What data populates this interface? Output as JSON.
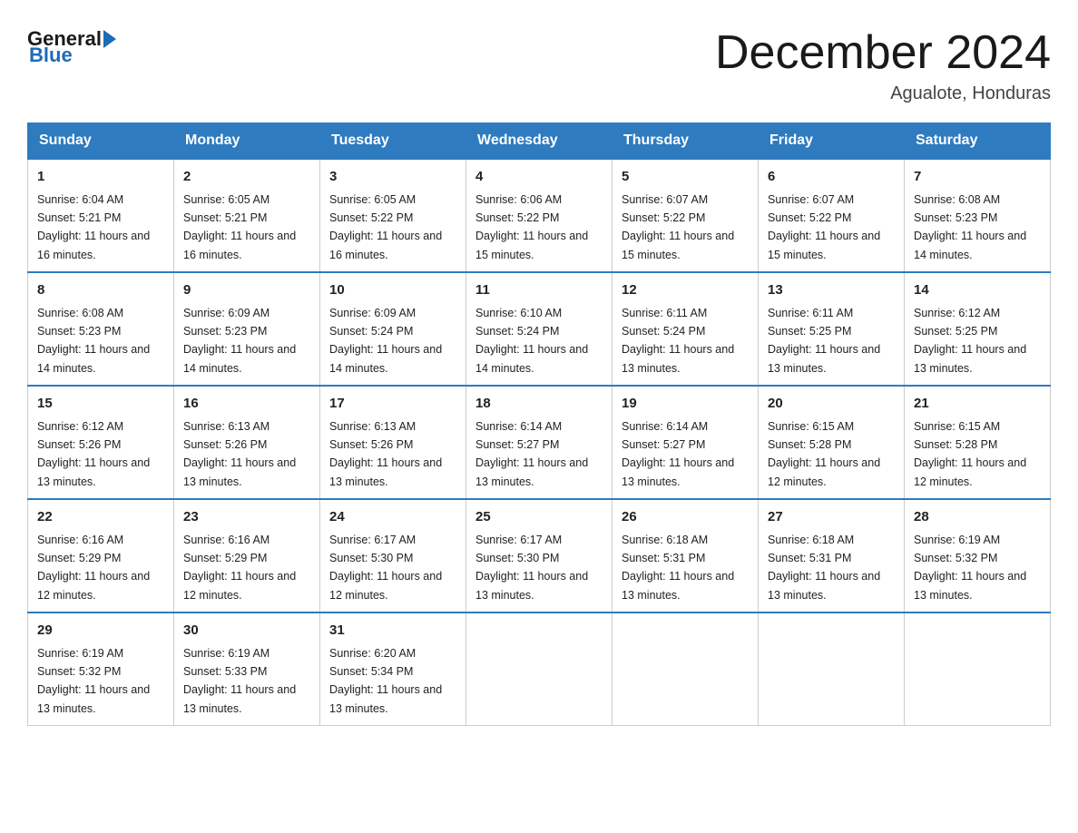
{
  "header": {
    "logo_general": "General",
    "logo_blue": "Blue",
    "title": "December 2024",
    "location": "Agualote, Honduras"
  },
  "days_of_week": [
    "Sunday",
    "Monday",
    "Tuesday",
    "Wednesday",
    "Thursday",
    "Friday",
    "Saturday"
  ],
  "weeks": [
    [
      {
        "day": "1",
        "sunrise": "6:04 AM",
        "sunset": "5:21 PM",
        "daylight": "11 hours and 16 minutes."
      },
      {
        "day": "2",
        "sunrise": "6:05 AM",
        "sunset": "5:21 PM",
        "daylight": "11 hours and 16 minutes."
      },
      {
        "day": "3",
        "sunrise": "6:05 AM",
        "sunset": "5:22 PM",
        "daylight": "11 hours and 16 minutes."
      },
      {
        "day": "4",
        "sunrise": "6:06 AM",
        "sunset": "5:22 PM",
        "daylight": "11 hours and 15 minutes."
      },
      {
        "day": "5",
        "sunrise": "6:07 AM",
        "sunset": "5:22 PM",
        "daylight": "11 hours and 15 minutes."
      },
      {
        "day": "6",
        "sunrise": "6:07 AM",
        "sunset": "5:22 PM",
        "daylight": "11 hours and 15 minutes."
      },
      {
        "day": "7",
        "sunrise": "6:08 AM",
        "sunset": "5:23 PM",
        "daylight": "11 hours and 14 minutes."
      }
    ],
    [
      {
        "day": "8",
        "sunrise": "6:08 AM",
        "sunset": "5:23 PM",
        "daylight": "11 hours and 14 minutes."
      },
      {
        "day": "9",
        "sunrise": "6:09 AM",
        "sunset": "5:23 PM",
        "daylight": "11 hours and 14 minutes."
      },
      {
        "day": "10",
        "sunrise": "6:09 AM",
        "sunset": "5:24 PM",
        "daylight": "11 hours and 14 minutes."
      },
      {
        "day": "11",
        "sunrise": "6:10 AM",
        "sunset": "5:24 PM",
        "daylight": "11 hours and 14 minutes."
      },
      {
        "day": "12",
        "sunrise": "6:11 AM",
        "sunset": "5:24 PM",
        "daylight": "11 hours and 13 minutes."
      },
      {
        "day": "13",
        "sunrise": "6:11 AM",
        "sunset": "5:25 PM",
        "daylight": "11 hours and 13 minutes."
      },
      {
        "day": "14",
        "sunrise": "6:12 AM",
        "sunset": "5:25 PM",
        "daylight": "11 hours and 13 minutes."
      }
    ],
    [
      {
        "day": "15",
        "sunrise": "6:12 AM",
        "sunset": "5:26 PM",
        "daylight": "11 hours and 13 minutes."
      },
      {
        "day": "16",
        "sunrise": "6:13 AM",
        "sunset": "5:26 PM",
        "daylight": "11 hours and 13 minutes."
      },
      {
        "day": "17",
        "sunrise": "6:13 AM",
        "sunset": "5:26 PM",
        "daylight": "11 hours and 13 minutes."
      },
      {
        "day": "18",
        "sunrise": "6:14 AM",
        "sunset": "5:27 PM",
        "daylight": "11 hours and 13 minutes."
      },
      {
        "day": "19",
        "sunrise": "6:14 AM",
        "sunset": "5:27 PM",
        "daylight": "11 hours and 13 minutes."
      },
      {
        "day": "20",
        "sunrise": "6:15 AM",
        "sunset": "5:28 PM",
        "daylight": "11 hours and 12 minutes."
      },
      {
        "day": "21",
        "sunrise": "6:15 AM",
        "sunset": "5:28 PM",
        "daylight": "11 hours and 12 minutes."
      }
    ],
    [
      {
        "day": "22",
        "sunrise": "6:16 AM",
        "sunset": "5:29 PM",
        "daylight": "11 hours and 12 minutes."
      },
      {
        "day": "23",
        "sunrise": "6:16 AM",
        "sunset": "5:29 PM",
        "daylight": "11 hours and 12 minutes."
      },
      {
        "day": "24",
        "sunrise": "6:17 AM",
        "sunset": "5:30 PM",
        "daylight": "11 hours and 12 minutes."
      },
      {
        "day": "25",
        "sunrise": "6:17 AM",
        "sunset": "5:30 PM",
        "daylight": "11 hours and 13 minutes."
      },
      {
        "day": "26",
        "sunrise": "6:18 AM",
        "sunset": "5:31 PM",
        "daylight": "11 hours and 13 minutes."
      },
      {
        "day": "27",
        "sunrise": "6:18 AM",
        "sunset": "5:31 PM",
        "daylight": "11 hours and 13 minutes."
      },
      {
        "day": "28",
        "sunrise": "6:19 AM",
        "sunset": "5:32 PM",
        "daylight": "11 hours and 13 minutes."
      }
    ],
    [
      {
        "day": "29",
        "sunrise": "6:19 AM",
        "sunset": "5:32 PM",
        "daylight": "11 hours and 13 minutes."
      },
      {
        "day": "30",
        "sunrise": "6:19 AM",
        "sunset": "5:33 PM",
        "daylight": "11 hours and 13 minutes."
      },
      {
        "day": "31",
        "sunrise": "6:20 AM",
        "sunset": "5:34 PM",
        "daylight": "11 hours and 13 minutes."
      },
      null,
      null,
      null,
      null
    ]
  ]
}
